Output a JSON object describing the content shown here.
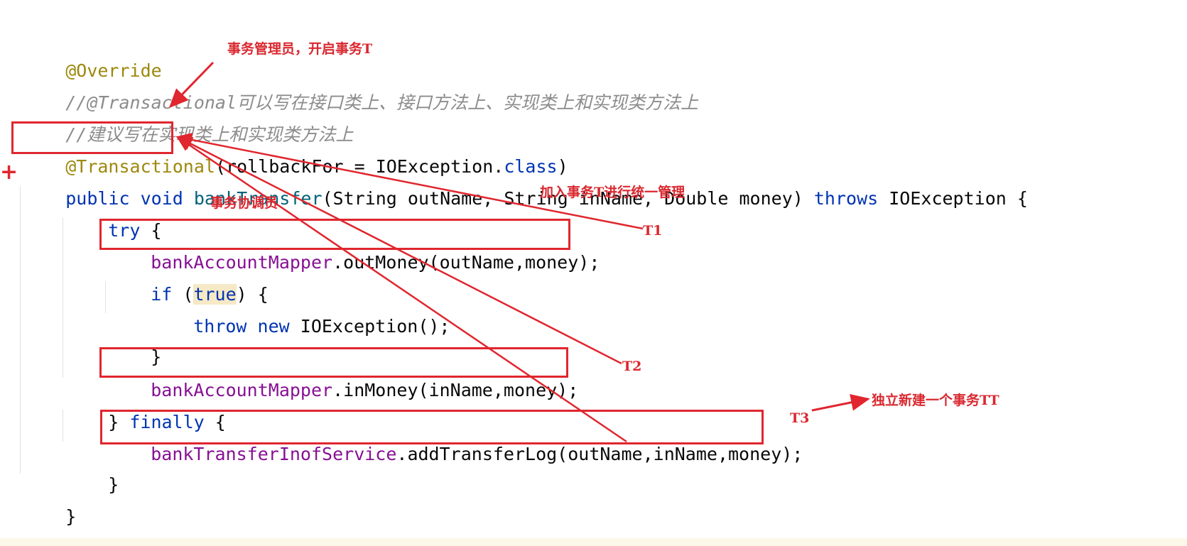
{
  "code": {
    "line1": {
      "annotation": "@Override"
    },
    "line2": {
      "comment": "//@Transactional可以写在接口类上、接口方法上、实现类上和实现类方法上"
    },
    "line3": {
      "comment": "//建议写在实现类上和实现类方法上"
    },
    "line4": {
      "annotation": "@Transactional",
      "rest": "(rollbackFor = IOException.",
      "class_kw": "class",
      "close": ")"
    },
    "line5": {
      "kw_public": "public",
      "kw_void": "void",
      "method": "bankTransfer",
      "params": "(String outName, String inName, Double money)",
      "kw_throws": "throws",
      "tail": "IOException {"
    },
    "line6": {
      "kw_try": "try",
      "tail": "{"
    },
    "line7": {
      "field": "bankAccountMapper",
      "call": ".outMoney(outName,money);"
    },
    "line8": {
      "kw_if": "if",
      "open": "(",
      "kw_true": "true",
      "close": ") {"
    },
    "line9": {
      "kw_throw": "throw",
      "kw_new": "new",
      "tail": "IOException();"
    },
    "line10": {
      "text": "}"
    },
    "line11": {
      "field": "bankAccountMapper",
      "call": ".inMoney(inName,money);"
    },
    "line12": {
      "brace": "}",
      "kw_finally": "finally",
      "tail": "{"
    },
    "line13": {
      "field": "bankTransferInofService",
      "call": ".addTransferLog(outName,inName,money);"
    },
    "line14": {
      "text": "}"
    },
    "line15": {
      "text": "}"
    }
  },
  "notes": {
    "manager": "事务管理员，开启事务T",
    "coordinator": "事务协调员",
    "join": "加入事务T进行统一管理",
    "t1": "T1",
    "t2": "T2",
    "t3": "T3",
    "independent": "独立新建一个事务TT"
  },
  "marks": {
    "plus": "+"
  },
  "colors": {
    "annotation": "#9e880d",
    "comment": "#8c8c8c",
    "keyword": "#0033b3",
    "method": "#00627a",
    "field": "#871094",
    "markup_red": "#e0262e"
  }
}
